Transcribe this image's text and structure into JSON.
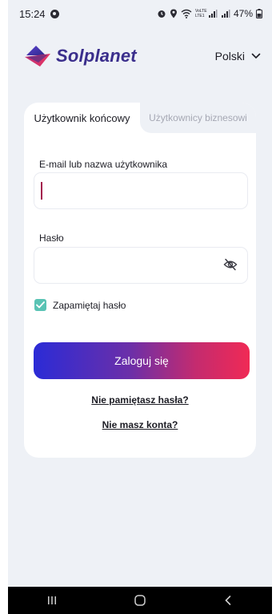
{
  "status_bar": {
    "time": "15:24",
    "battery": "47%",
    "network_label": "VoLTE LTE1"
  },
  "header": {
    "brand_name": "Solplanet",
    "language": "Polski",
    "brand_color": "#3a2e8c"
  },
  "tabs": [
    {
      "label": "Użytkownik końcowy",
      "active": true
    },
    {
      "label": "Użytkownicy biznesowi",
      "active": false
    }
  ],
  "form": {
    "username_label": "E-mail lub nazwa użytkownika",
    "username_value": "",
    "password_label": "Hasło",
    "password_value": "",
    "remember_label": "Zapamiętaj hasło",
    "remember_checked": true,
    "login_button": "Zaloguj się",
    "forgot_link": "Nie pamiętasz hasła?",
    "register_link": "Nie masz konta?"
  },
  "colors": {
    "accent_teal": "#59c3b4",
    "gradient_start": "#2b2bd6",
    "gradient_end": "#f02a55",
    "cursor": "#a3174d"
  },
  "icons": {
    "brand": "solplanet-logo-icon",
    "language": "chevron-down-icon",
    "password_toggle": "eye-off-icon",
    "remember": "checkmark-icon",
    "nav": [
      "recent-apps-icon",
      "home-icon",
      "back-icon"
    ]
  }
}
